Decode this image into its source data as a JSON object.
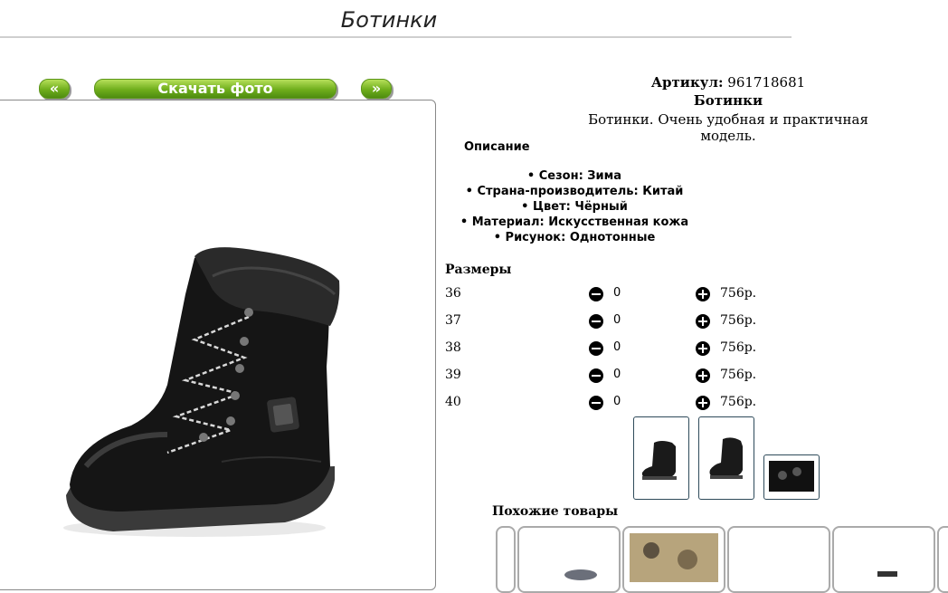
{
  "header": {
    "title": "Ботинки"
  },
  "gallery": {
    "prev_label": "«",
    "download_label": "Скачать фото",
    "next_label": "»"
  },
  "product": {
    "article_label": "Артикул:",
    "article_value": "961718681",
    "name": "Ботинки",
    "description": "Ботинки. Очень удобная и практичная модель."
  },
  "description_section": {
    "heading": "Описание",
    "specs": [
      "• Сезон: Зима",
      "• Страна-производитель: Китай",
      "• Цвет: Чёрный",
      "• Материал: Искусственная кожа",
      "• Рисунок: Однотонные"
    ]
  },
  "sizes": {
    "heading": "Размеры",
    "rows": [
      {
        "size": "36",
        "qty": "0",
        "price": "756р."
      },
      {
        "size": "37",
        "qty": "0",
        "price": "756р."
      },
      {
        "size": "38",
        "qty": "0",
        "price": "756р."
      },
      {
        "size": "39",
        "qty": "0",
        "price": "756р."
      },
      {
        "size": "40",
        "qty": "0",
        "price": "756р."
      }
    ]
  },
  "similar": {
    "heading": "Похожие товары"
  },
  "colors": {
    "button_green": "#6fae1c",
    "frame_border": "#888888"
  }
}
